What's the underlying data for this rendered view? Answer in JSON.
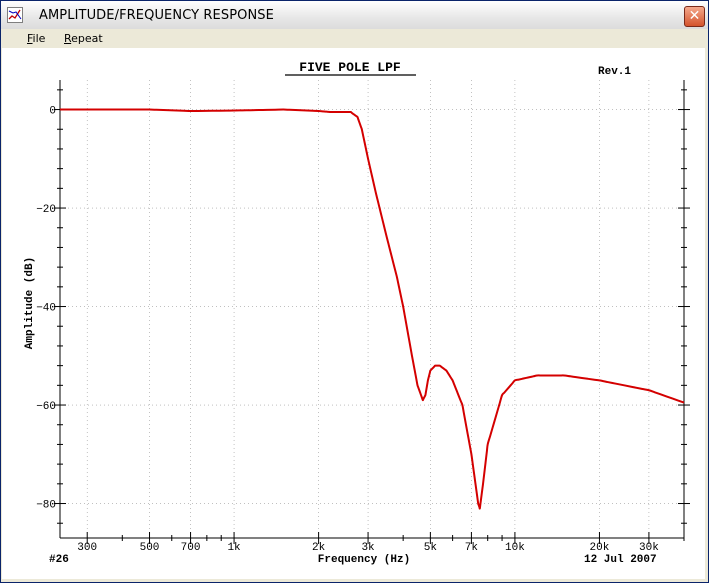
{
  "window": {
    "title": "AMPLITUDE/FREQUENCY RESPONSE",
    "close_glyph": "✕"
  },
  "menu": [
    {
      "label": "File",
      "accel": "F",
      "rest": "ile"
    },
    {
      "label": "Repeat",
      "accel": "R",
      "rest": "epeat"
    }
  ],
  "plot": {
    "id_label": "#26",
    "revision": "Rev.1",
    "date": "12 Jul 2007",
    "line_color": "#d40000"
  },
  "chart_data": {
    "type": "line",
    "title": "FIVE POLE LPF",
    "xlabel": "Frequency (Hz)",
    "ylabel": "Amplitude (dB)",
    "xscale": "log",
    "xlim": [
      240,
      40000
    ],
    "ylim": [
      -87,
      6
    ],
    "x_ticks": [
      300,
      500,
      700,
      1000,
      2000,
      3000,
      5000,
      7000,
      10000,
      20000,
      30000
    ],
    "x_tick_labels": [
      "300",
      "500",
      "700",
      "1k",
      "2k",
      "3k",
      "5k",
      "7k",
      "10k",
      "20k",
      "30k"
    ],
    "y_ticks": [
      0,
      -20,
      -40,
      -60,
      -80
    ],
    "y_tick_labels": [
      "0",
      "−20",
      "−40",
      "−60",
      "−80"
    ],
    "grid": true,
    "series": [
      {
        "x": [
          240,
          500,
          700,
          1000,
          1500,
          2000,
          2200,
          2600,
          2750,
          2850,
          3000,
          3200,
          3500,
          3800,
          4000,
          4300,
          4500,
          4700,
          4800,
          4900,
          5000,
          5200,
          5400,
          5700,
          6000,
          6500,
          7000,
          7400,
          7500,
          7700,
          8000,
          9000,
          10000,
          12000,
          15000,
          20000,
          30000,
          40000
        ],
        "y": [
          0,
          0,
          -0.3,
          -0.2,
          0,
          -0.3,
          -0.5,
          -0.5,
          -1.5,
          -4,
          -10,
          -17,
          -26,
          -34,
          -40,
          -50,
          -56,
          -59,
          -58,
          -55,
          -53,
          -52,
          -52,
          -53,
          -55,
          -60,
          -70,
          -80,
          -81,
          -76,
          -68,
          -58,
          -55,
          -54,
          -54,
          -55,
          -57,
          -59.5
        ]
      }
    ]
  }
}
